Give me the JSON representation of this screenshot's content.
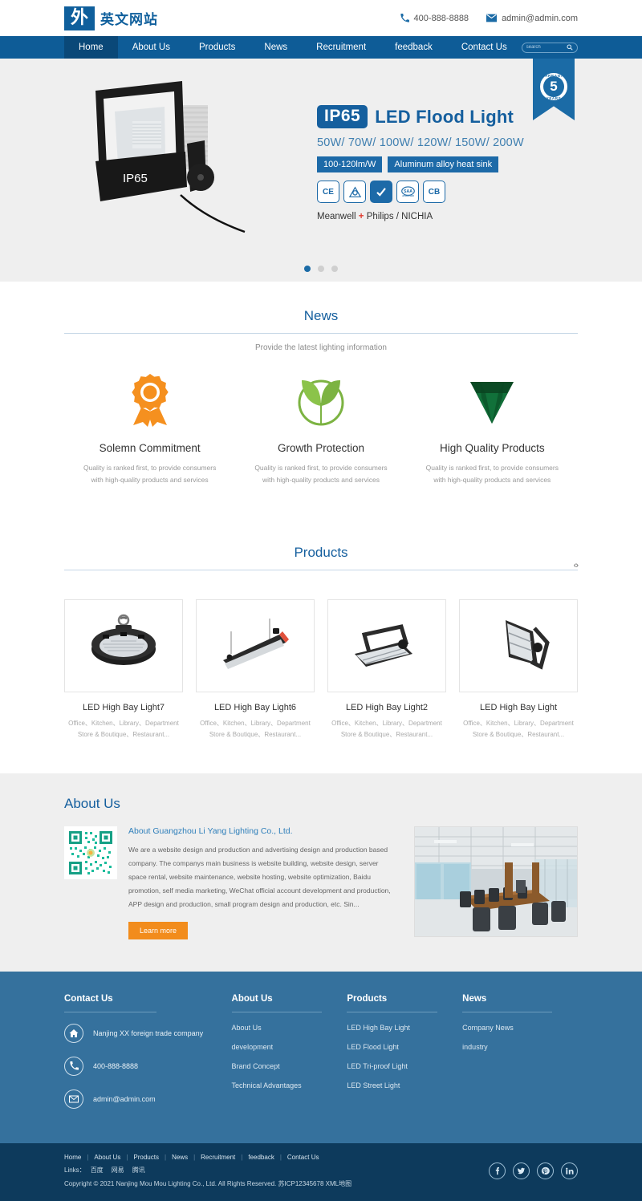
{
  "header": {
    "logo_mark": "外",
    "logo_text": "英文网站",
    "phone_icon": "phone-icon",
    "phone": "400-888-8888",
    "mail_icon": "mail-icon",
    "email": "admin@admin.com"
  },
  "nav": {
    "items": [
      {
        "label": "Home",
        "active": true
      },
      {
        "label": "About Us",
        "active": false
      },
      {
        "label": "Products",
        "active": false
      },
      {
        "label": "News",
        "active": false
      },
      {
        "label": "Recruitment",
        "active": false
      },
      {
        "label": "feedback",
        "active": false
      },
      {
        "label": "Contact Us",
        "active": false
      }
    ],
    "search_placeholder": "search",
    "search_value": "",
    "search_icon": "search-icon"
  },
  "hero": {
    "image_alt": "led-flood-light-product",
    "ip_badge": "IP65",
    "title": "LED Flood Light",
    "wattage": "50W/ 70W/ 100W/ 120W/ 150W/ 200W",
    "tag1": "100-120lm/W",
    "tag2": "Aluminum alloy heat sink",
    "certs": [
      "CE",
      "RCM",
      "C",
      "SAA",
      "CB"
    ],
    "brands_pre": "Meanwell ",
    "brands_plus": "+",
    "brands_post": " Philips / NICHIA",
    "ribbon_top": "WARRANTY",
    "ribbon_number": "5",
    "ribbon_bottom": "YEARS",
    "dots": [
      true,
      false,
      false
    ]
  },
  "news": {
    "title": "News",
    "subtitle": "Provide the latest lighting information",
    "features": [
      {
        "icon": "award-ribbon-icon",
        "color": "#f5901f",
        "title": "Solemn Commitment",
        "desc": "Quality is ranked first, to provide consumers with high-quality products and services"
      },
      {
        "icon": "sprout-leaf-icon",
        "color": "#7cb342",
        "title": "Growth Protection",
        "desc": "Quality is ranked first, to provide consumers with high-quality products and services"
      },
      {
        "icon": "diamond-icon",
        "color": "#0f5d2e",
        "title": "High Quality Products",
        "desc": "Quality is ranked first, to provide consumers with high-quality products and services"
      }
    ]
  },
  "products": {
    "title": "Products",
    "prev_icon": "chevron-left-icon",
    "next_icon": "chevron-right-icon",
    "items": [
      {
        "image": "ufo-high-bay-light",
        "name": "LED High Bay Light7",
        "desc": "Office、Kitchen、Library、Department Store & Boutique、Restaurant..."
      },
      {
        "image": "linear-bay-light",
        "name": "LED High Bay Light6",
        "desc": "Office、Kitchen、Library、Department Store & Boutique、Restaurant..."
      },
      {
        "image": "modular-flood-light-angled",
        "name": "LED High Bay Light2",
        "desc": "Office、Kitchen、Library、Department Store & Boutique、Restaurant..."
      },
      {
        "image": "modular-flood-light-upright",
        "name": "LED High Bay Light",
        "desc": "Office、Kitchen、Library、Department Store & Boutique、Restaurant..."
      }
    ]
  },
  "about": {
    "title": "About Us",
    "qr_alt": "qr-code",
    "heading": "About Guangzhou Li Yang Lighting Co., Ltd.",
    "paragraph": "We are a website design and production and advertising design and production based company. The companys main business is website building, website design, server space rental, website maintenance, website hosting, website optimization, Baidu promotion, self media marketing, WeChat official account development and production, APP design and production, small program design and production, etc. Sin...",
    "button": "Learn more",
    "image_alt": "office-conference-room"
  },
  "footer": {
    "contact": {
      "title": "Contact Us",
      "items": [
        {
          "icon": "home-icon",
          "text": "Nanjing XX foreign trade company"
        },
        {
          "icon": "phone-icon",
          "text": "400-888-8888"
        },
        {
          "icon": "mail-icon",
          "text": "admin@admin.com"
        }
      ]
    },
    "about": {
      "title": "About Us",
      "links": [
        "About Us",
        "development",
        "Brand Concept",
        "Technical Advantages"
      ]
    },
    "products": {
      "title": "Products",
      "links": [
        "LED High Bay Light",
        "LED Flood Light",
        "LED Tri-proof Light",
        "LED Street Light"
      ]
    },
    "news": {
      "title": "News",
      "links": [
        "Company News",
        "industry"
      ]
    }
  },
  "bottom": {
    "nav": [
      "Home",
      "About Us",
      "Products",
      "News",
      "Recruitment",
      "feedback",
      "Contact Us"
    ],
    "links_label": "Links：",
    "links": [
      "百度",
      "网易",
      "腾讯"
    ],
    "copyright": "Copyright © 2021 Nanjing Mou Mou Lighting Co., Ltd. All Rights Reserved. 苏ICP12345678 XML地图",
    "socials": [
      {
        "icon": "facebook-icon",
        "glyph": "f"
      },
      {
        "icon": "twitter-icon",
        "glyph": "t"
      },
      {
        "icon": "pinterest-icon",
        "glyph": "P"
      },
      {
        "icon": "linkedin-icon",
        "glyph": "in"
      }
    ]
  },
  "colors": {
    "brand_blue": "#0e5c97",
    "nav_active": "#0a4878",
    "accent_orange": "#f28c1c",
    "footer_blue": "#35719d",
    "bottom_blue": "#0d3a5c"
  }
}
